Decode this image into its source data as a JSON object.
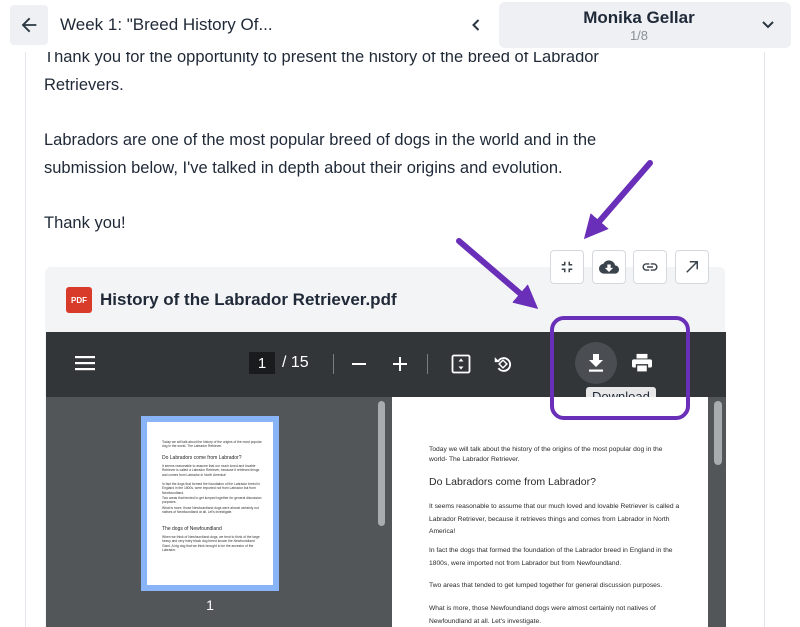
{
  "header": {
    "title": "Week 1: \"Breed History Of...",
    "student": {
      "name": "Monika Gellar",
      "position": "1/8"
    }
  },
  "message": {
    "line1": "Thank you for the opportunity to present the history of the breed of Labrador",
    "line2": "Retrievers.",
    "line3": "Labradors are one of the most popular breed of dogs in the world and in the",
    "line4": "submission below, I've talked in depth about their origins and evolution.",
    "line5": "Thank you!"
  },
  "attachment": {
    "badge": "PDF",
    "file_name": "History of the Labrador Retriever.pdf",
    "actions": [
      "collapse-icon",
      "cloud-download-icon",
      "link-icon",
      "open-external-icon"
    ]
  },
  "viewer": {
    "current_page": "1",
    "total": "/ 15",
    "tooltip": "Download",
    "thumbnail_label": "1",
    "thumbnail": {
      "intro": "Today we will talk about the history of the origins of the most popular dog in the world- The Labrador Retriever.",
      "heading1": "Do Labradors come from Labrador?",
      "p1": "It seems reasonable to assume that our much loved and lovable Retriever is called a Labrador Retriever, because it retrieves things and comes from Labrador in North America!",
      "p2": "In fact the dogs that formed the foundation of the Labrador breed in England in the 1800s, were imported not from Labrador but from Newfoundland.",
      "p3": "Two areas that tended to get lumped together for general discussion purposes.",
      "p4": "What is more, those Newfoundland dogs were almost certainly not natives of Newfoundland at all. Let's investigate.",
      "heading2": "The dogs of Newfoundland",
      "p5": "When we think of Newfoundland dogs, we tend to think of the large heavy and very hairy black dog breed known the Newfoundland Giant. A big dog that we think brought to be the ancestor of the Labrador."
    },
    "page": {
      "intro": "Today we will talk about the history of the origins of the most popular dog in the world- The Labrador Retriever.",
      "heading": "Do Labradors come from Labrador?",
      "p1": "It seems reasonable to assume that our much loved and lovable Retriever is called a Labrador Retriever, because it retrieves things and comes from Labrador in North America!",
      "p2": "In fact the dogs that formed the foundation of the Labrador breed in England in the 1800s, were imported not from Labrador but from Newfoundland.",
      "p3": "Two areas that tended to get lumped together for general discussion purposes.",
      "p4": "What is more, those Newfoundland dogs were almost certainly not natives of Newfoundland at all. Let's investigate."
    }
  },
  "colors": {
    "annotation": "#6a2fb8",
    "pdf_badge": "#d93b2b",
    "viewer_toolbar": "#323639",
    "viewer_body": "#525659",
    "thumbnail_selected": "#8ab4f8"
  }
}
